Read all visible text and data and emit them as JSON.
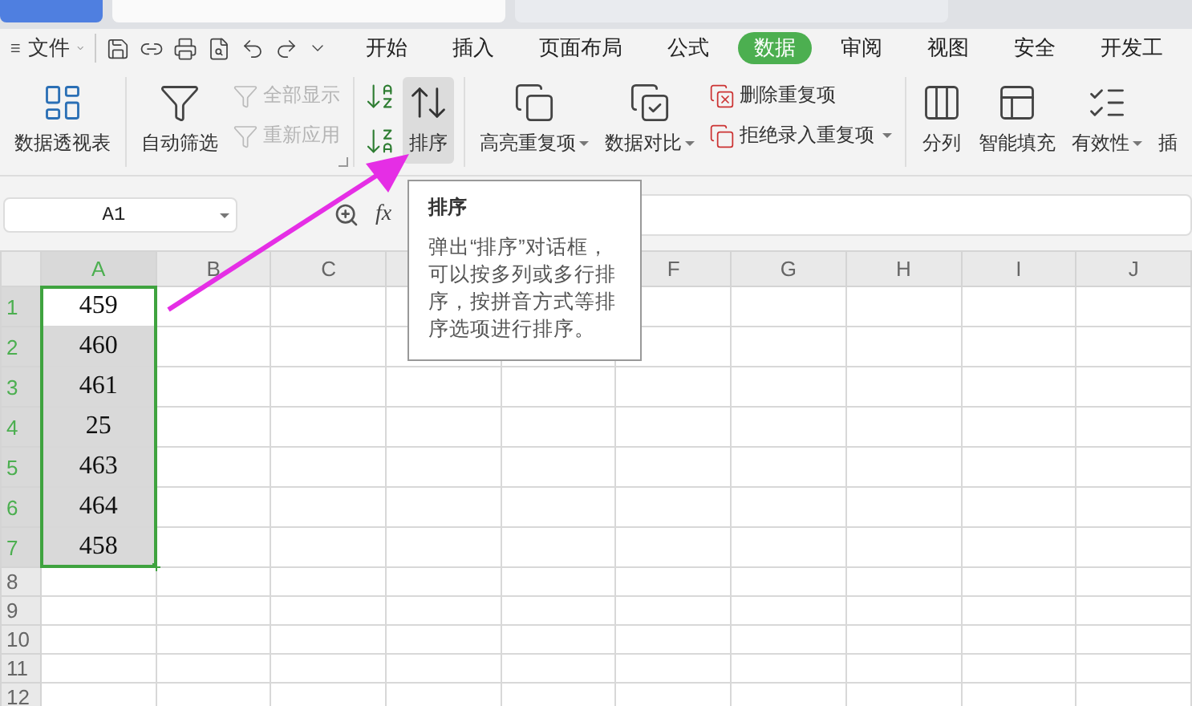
{
  "menu": {
    "label": "文件"
  },
  "tabs": [
    {
      "label": "开始",
      "selected": false
    },
    {
      "label": "插入",
      "selected": false
    },
    {
      "label": "页面布局",
      "selected": false
    },
    {
      "label": "公式",
      "selected": false
    },
    {
      "label": "数据",
      "selected": true
    },
    {
      "label": "审阅",
      "selected": false
    },
    {
      "label": "视图",
      "selected": false
    },
    {
      "label": "安全",
      "selected": false
    },
    {
      "label": "开发工",
      "selected": false
    }
  ],
  "ribbon": {
    "groups": [
      {
        "items": [
          {
            "kind": "large",
            "label": "数据透视表",
            "dropdown": false,
            "highlighted": false
          }
        ]
      },
      {
        "launcher": true,
        "items": [
          {
            "kind": "large",
            "label": "自动筛选",
            "dropdown": false,
            "highlighted": false
          },
          {
            "kind": "small_stack",
            "items": [
              {
                "label": "全部显示",
                "disabled": true,
                "dropdown": false
              },
              {
                "label": "重新应用",
                "disabled": true,
                "dropdown": false
              }
            ]
          }
        ]
      },
      {
        "items": [
          {
            "kind": "icon_stack"
          },
          {
            "kind": "large",
            "label": "排序",
            "dropdown": false,
            "highlighted": true
          }
        ]
      },
      {
        "items": [
          {
            "kind": "large",
            "label": "高亮重复项",
            "dropdown": true,
            "highlighted": false
          },
          {
            "kind": "large",
            "label": "数据对比",
            "dropdown": true,
            "highlighted": false
          },
          {
            "kind": "small_stack",
            "items": [
              {
                "label": "删除重复项",
                "disabled": false,
                "dropdown": false
              },
              {
                "label": "拒绝录入重复项",
                "disabled": false,
                "dropdown": true
              }
            ]
          }
        ]
      },
      {
        "items": [
          {
            "kind": "large",
            "label": "分列",
            "dropdown": false,
            "highlighted": false
          },
          {
            "kind": "large",
            "label": "智能填充",
            "dropdown": false,
            "highlighted": false
          },
          {
            "kind": "large",
            "label": "有效性",
            "dropdown": true,
            "highlighted": false
          },
          {
            "kind": "large",
            "label": "插",
            "dropdown": false,
            "highlighted": false
          }
        ]
      }
    ]
  },
  "formula_bar": {
    "name_box": "A1",
    "fx": "fx"
  },
  "tooltip": {
    "title": "排序",
    "body": "弹出“排序”对话框，可以按多列或多行排序，按拼音方式等排序选项进行排序。"
  },
  "sheet": {
    "columns": [
      {
        "label": "A",
        "selected": true
      },
      {
        "label": "B",
        "selected": false
      },
      {
        "label": "C",
        "selected": false
      },
      {},
      {},
      {
        "label": "F",
        "selected": false
      },
      {
        "label": "G",
        "selected": false
      },
      {
        "label": "H",
        "selected": false
      },
      {
        "label": "I",
        "selected": false
      },
      {
        "label": "J",
        "selected": false
      }
    ],
    "rows": [
      {
        "label": "1",
        "selected": true,
        "cells": [
          {
            "text": "459",
            "selected": true,
            "active": true
          }
        ]
      },
      {
        "label": "2",
        "selected": true,
        "cells": [
          {
            "text": "460",
            "selected": true,
            "active": false
          }
        ]
      },
      {
        "label": "3",
        "selected": true,
        "cells": [
          {
            "text": "461",
            "selected": true,
            "active": false
          }
        ]
      },
      {
        "label": "4",
        "selected": true,
        "cells": [
          {
            "text": "25",
            "selected": true,
            "active": false
          }
        ]
      },
      {
        "label": "5",
        "selected": true,
        "cells": [
          {
            "text": "463",
            "selected": true,
            "active": false
          }
        ]
      },
      {
        "label": "6",
        "selected": true,
        "cells": [
          {
            "text": "464",
            "selected": true,
            "active": false
          }
        ]
      },
      {
        "label": "7",
        "selected": true,
        "cells": [
          {
            "text": "458",
            "selected": true,
            "active": false
          }
        ]
      },
      {
        "label": "8",
        "selected": false,
        "cells": []
      },
      {
        "label": "9",
        "selected": false,
        "cells": []
      },
      {
        "label": "10",
        "selected": false,
        "cells": []
      },
      {
        "label": "11",
        "selected": false,
        "cells": []
      },
      {
        "label": "12",
        "selected": false,
        "cells": []
      }
    ]
  }
}
